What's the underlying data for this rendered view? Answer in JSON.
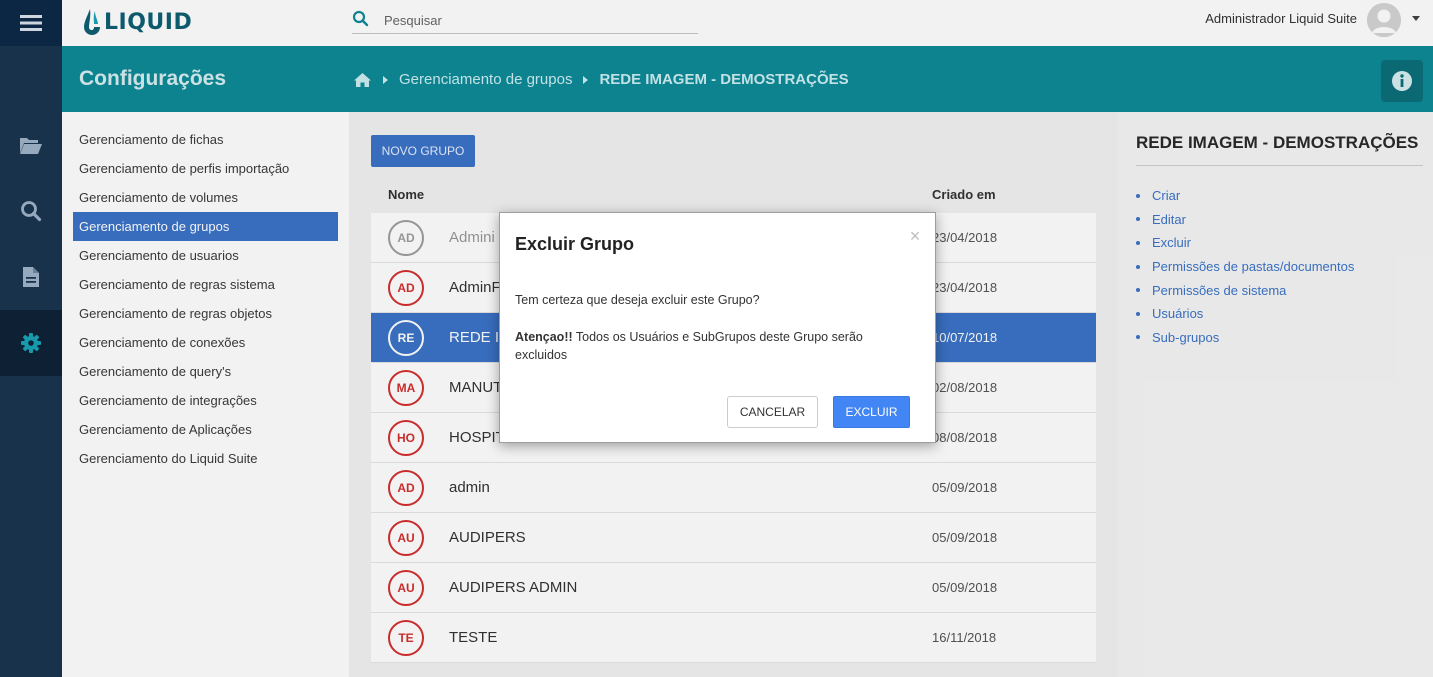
{
  "app": {
    "logo_text": "LIQUID",
    "search_placeholder": "Pesquisar",
    "user_name": "Administrador Liquid Suite"
  },
  "header": {
    "title": "Configurações",
    "breadcrumb": [
      "Gerenciamento de grupos",
      "REDE IMAGEM - DEMOSTRAÇÕES"
    ]
  },
  "rail": {
    "items": [
      {
        "icon": "folder-open-icon"
      },
      {
        "icon": "search-icon"
      },
      {
        "icon": "document-icon"
      },
      {
        "icon": "gear-icon",
        "active": true
      }
    ]
  },
  "submenu": {
    "items": [
      "Gerenciamento de fichas",
      "Gerenciamento de perfis importação",
      "Gerenciamento de volumes",
      "Gerenciamento de grupos",
      "Gerenciamento de usuarios",
      "Gerenciamento de regras sistema",
      "Gerenciamento de regras objetos",
      "Gerenciamento de conexões",
      "Gerenciamento de query's",
      "Gerenciamento de integrações",
      "Gerenciamento de Aplicações",
      "Gerenciamento do Liquid Suite"
    ],
    "active_index": 3
  },
  "main": {
    "new_button": "NOVO GRUPO",
    "columns": {
      "name": "Nome",
      "created": "Criado em"
    },
    "rows": [
      {
        "initials": "AD",
        "name": "Admini",
        "date": "23/04/2018",
        "style": "grey"
      },
      {
        "initials": "AD",
        "name": "AdminF",
        "date": "23/04/2018",
        "style": "red"
      },
      {
        "initials": "RE",
        "name": "REDE IM",
        "date": "10/07/2018",
        "style": "selected"
      },
      {
        "initials": "MA",
        "name": "MANUT",
        "date": "02/08/2018",
        "style": "red"
      },
      {
        "initials": "HO",
        "name": "HOSPIT",
        "date": "08/08/2018",
        "style": "red"
      },
      {
        "initials": "AD",
        "name": "admin",
        "date": "05/09/2018",
        "style": "red"
      },
      {
        "initials": "AU",
        "name": "AUDIPERS",
        "date": "05/09/2018",
        "style": "red"
      },
      {
        "initials": "AU",
        "name": "AUDIPERS ADMIN",
        "date": "05/09/2018",
        "style": "red"
      },
      {
        "initials": "TE",
        "name": "TESTE",
        "date": "16/11/2018",
        "style": "red"
      }
    ]
  },
  "right_panel": {
    "title": "REDE IMAGEM - DEMOSTRAÇÕES",
    "links": [
      "Criar",
      "Editar",
      "Excluir",
      "Permissões de pastas/documentos",
      "Permissões de sistema",
      "Usuários",
      "Sub-grupos"
    ]
  },
  "modal": {
    "title": "Excluir Grupo",
    "close": "×",
    "question": "Tem certeza que deseja excluir este Grupo?",
    "warning_label": "Atençao!!",
    "warning_text": " Todos os Usuários e SubGrupos deste Grupo serão excluidos",
    "cancel": "CANCELAR",
    "confirm": "EXCLUIR"
  },
  "colors": {
    "header": "#0e8b98",
    "rail": "#1b3550",
    "accent": "#3b73c8",
    "danger": "#d32f2f",
    "confirm": "#4285f4"
  }
}
